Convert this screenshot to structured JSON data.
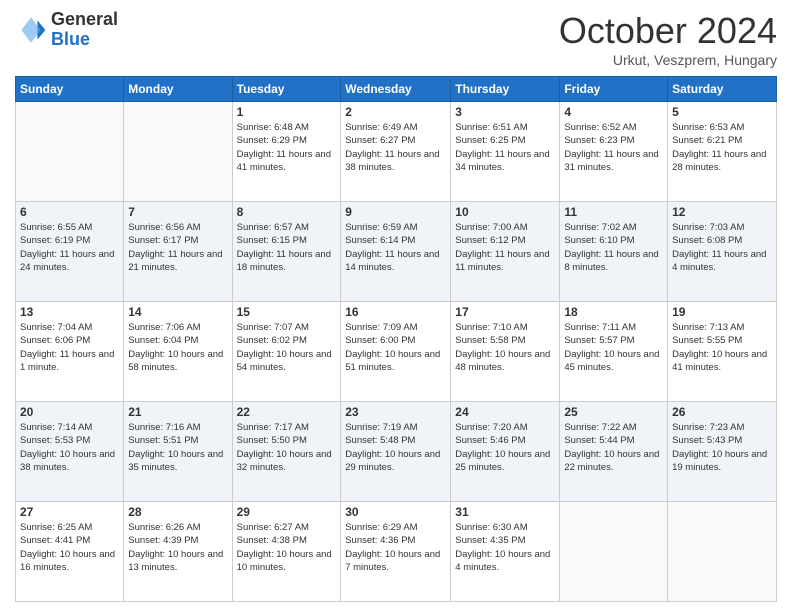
{
  "logo": {
    "general": "General",
    "blue": "Blue"
  },
  "header": {
    "month": "October 2024",
    "location": "Urkut, Veszprem, Hungary"
  },
  "days_of_week": [
    "Sunday",
    "Monday",
    "Tuesday",
    "Wednesday",
    "Thursday",
    "Friday",
    "Saturday"
  ],
  "weeks": [
    [
      {
        "day": "",
        "sunrise": "",
        "sunset": "",
        "daylight": ""
      },
      {
        "day": "",
        "sunrise": "",
        "sunset": "",
        "daylight": ""
      },
      {
        "day": "1",
        "sunrise": "Sunrise: 6:48 AM",
        "sunset": "Sunset: 6:29 PM",
        "daylight": "Daylight: 11 hours and 41 minutes."
      },
      {
        "day": "2",
        "sunrise": "Sunrise: 6:49 AM",
        "sunset": "Sunset: 6:27 PM",
        "daylight": "Daylight: 11 hours and 38 minutes."
      },
      {
        "day": "3",
        "sunrise": "Sunrise: 6:51 AM",
        "sunset": "Sunset: 6:25 PM",
        "daylight": "Daylight: 11 hours and 34 minutes."
      },
      {
        "day": "4",
        "sunrise": "Sunrise: 6:52 AM",
        "sunset": "Sunset: 6:23 PM",
        "daylight": "Daylight: 11 hours and 31 minutes."
      },
      {
        "day": "5",
        "sunrise": "Sunrise: 6:53 AM",
        "sunset": "Sunset: 6:21 PM",
        "daylight": "Daylight: 11 hours and 28 minutes."
      }
    ],
    [
      {
        "day": "6",
        "sunrise": "Sunrise: 6:55 AM",
        "sunset": "Sunset: 6:19 PM",
        "daylight": "Daylight: 11 hours and 24 minutes."
      },
      {
        "day": "7",
        "sunrise": "Sunrise: 6:56 AM",
        "sunset": "Sunset: 6:17 PM",
        "daylight": "Daylight: 11 hours and 21 minutes."
      },
      {
        "day": "8",
        "sunrise": "Sunrise: 6:57 AM",
        "sunset": "Sunset: 6:15 PM",
        "daylight": "Daylight: 11 hours and 18 minutes."
      },
      {
        "day": "9",
        "sunrise": "Sunrise: 6:59 AM",
        "sunset": "Sunset: 6:14 PM",
        "daylight": "Daylight: 11 hours and 14 minutes."
      },
      {
        "day": "10",
        "sunrise": "Sunrise: 7:00 AM",
        "sunset": "Sunset: 6:12 PM",
        "daylight": "Daylight: 11 hours and 11 minutes."
      },
      {
        "day": "11",
        "sunrise": "Sunrise: 7:02 AM",
        "sunset": "Sunset: 6:10 PM",
        "daylight": "Daylight: 11 hours and 8 minutes."
      },
      {
        "day": "12",
        "sunrise": "Sunrise: 7:03 AM",
        "sunset": "Sunset: 6:08 PM",
        "daylight": "Daylight: 11 hours and 4 minutes."
      }
    ],
    [
      {
        "day": "13",
        "sunrise": "Sunrise: 7:04 AM",
        "sunset": "Sunset: 6:06 PM",
        "daylight": "Daylight: 11 hours and 1 minute."
      },
      {
        "day": "14",
        "sunrise": "Sunrise: 7:06 AM",
        "sunset": "Sunset: 6:04 PM",
        "daylight": "Daylight: 10 hours and 58 minutes."
      },
      {
        "day": "15",
        "sunrise": "Sunrise: 7:07 AM",
        "sunset": "Sunset: 6:02 PM",
        "daylight": "Daylight: 10 hours and 54 minutes."
      },
      {
        "day": "16",
        "sunrise": "Sunrise: 7:09 AM",
        "sunset": "Sunset: 6:00 PM",
        "daylight": "Daylight: 10 hours and 51 minutes."
      },
      {
        "day": "17",
        "sunrise": "Sunrise: 7:10 AM",
        "sunset": "Sunset: 5:58 PM",
        "daylight": "Daylight: 10 hours and 48 minutes."
      },
      {
        "day": "18",
        "sunrise": "Sunrise: 7:11 AM",
        "sunset": "Sunset: 5:57 PM",
        "daylight": "Daylight: 10 hours and 45 minutes."
      },
      {
        "day": "19",
        "sunrise": "Sunrise: 7:13 AM",
        "sunset": "Sunset: 5:55 PM",
        "daylight": "Daylight: 10 hours and 41 minutes."
      }
    ],
    [
      {
        "day": "20",
        "sunrise": "Sunrise: 7:14 AM",
        "sunset": "Sunset: 5:53 PM",
        "daylight": "Daylight: 10 hours and 38 minutes."
      },
      {
        "day": "21",
        "sunrise": "Sunrise: 7:16 AM",
        "sunset": "Sunset: 5:51 PM",
        "daylight": "Daylight: 10 hours and 35 minutes."
      },
      {
        "day": "22",
        "sunrise": "Sunrise: 7:17 AM",
        "sunset": "Sunset: 5:50 PM",
        "daylight": "Daylight: 10 hours and 32 minutes."
      },
      {
        "day": "23",
        "sunrise": "Sunrise: 7:19 AM",
        "sunset": "Sunset: 5:48 PM",
        "daylight": "Daylight: 10 hours and 29 minutes."
      },
      {
        "day": "24",
        "sunrise": "Sunrise: 7:20 AM",
        "sunset": "Sunset: 5:46 PM",
        "daylight": "Daylight: 10 hours and 25 minutes."
      },
      {
        "day": "25",
        "sunrise": "Sunrise: 7:22 AM",
        "sunset": "Sunset: 5:44 PM",
        "daylight": "Daylight: 10 hours and 22 minutes."
      },
      {
        "day": "26",
        "sunrise": "Sunrise: 7:23 AM",
        "sunset": "Sunset: 5:43 PM",
        "daylight": "Daylight: 10 hours and 19 minutes."
      }
    ],
    [
      {
        "day": "27",
        "sunrise": "Sunrise: 6:25 AM",
        "sunset": "Sunset: 4:41 PM",
        "daylight": "Daylight: 10 hours and 16 minutes."
      },
      {
        "day": "28",
        "sunrise": "Sunrise: 6:26 AM",
        "sunset": "Sunset: 4:39 PM",
        "daylight": "Daylight: 10 hours and 13 minutes."
      },
      {
        "day": "29",
        "sunrise": "Sunrise: 6:27 AM",
        "sunset": "Sunset: 4:38 PM",
        "daylight": "Daylight: 10 hours and 10 minutes."
      },
      {
        "day": "30",
        "sunrise": "Sunrise: 6:29 AM",
        "sunset": "Sunset: 4:36 PM",
        "daylight": "Daylight: 10 hours and 7 minutes."
      },
      {
        "day": "31",
        "sunrise": "Sunrise: 6:30 AM",
        "sunset": "Sunset: 4:35 PM",
        "daylight": "Daylight: 10 hours and 4 minutes."
      },
      {
        "day": "",
        "sunrise": "",
        "sunset": "",
        "daylight": ""
      },
      {
        "day": "",
        "sunrise": "",
        "sunset": "",
        "daylight": ""
      }
    ]
  ]
}
